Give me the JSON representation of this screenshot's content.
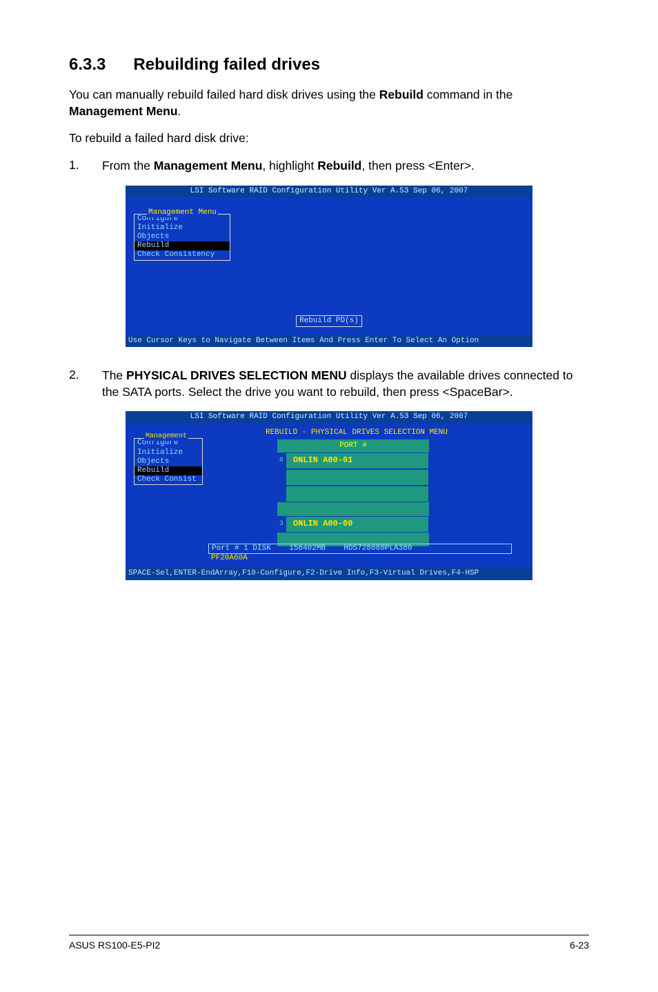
{
  "heading": {
    "num": "6.3.3",
    "title": "Rebuilding failed drives"
  },
  "intro_p1_a": "You can manually rebuild failed hard disk drives using the ",
  "intro_p1_b": "Rebuild",
  "intro_p1_c": " command in the ",
  "intro_p1_d": "Management Menu",
  "intro_p1_e": ".",
  "intro_p2": "To rebuild a failed hard disk drive:",
  "step1": {
    "num": "1.",
    "a": "From the ",
    "b": "Management Menu",
    "c": ", highlight ",
    "d": "Rebuild",
    "e": ", then press <Enter>."
  },
  "step2": {
    "num": "2.",
    "a": "The ",
    "b": "PHYSICAL DRIVES SELECTION MENU",
    "c": " displays the available drives connected to the SATA ports. Select the drive you want to rebuild, then press <SpaceBar>."
  },
  "term": {
    "title": "LSI Software RAID Configuration Utility Ver A.53 Sep 06, 2007",
    "mgmt_title": "Management Menu",
    "items": [
      "Configure",
      "Initialize",
      "Objects",
      "Rebuild",
      "Check Consistency"
    ],
    "mgmt_title_sm": "Management",
    "items_sm": [
      "Configure",
      "Initialize",
      "Objects",
      "Rebuild",
      "Check Consist"
    ],
    "rebuild_box": "Rebuild PD(s)",
    "footer1": "Use Cursor Keys to Navigate Between Items And Press Enter To Select An Option",
    "rebuild_frame_title": "REBUILD - PHYSICAL DRIVES SELECTION MENU",
    "port_header": "PORT #",
    "drives": [
      {
        "idx": "0",
        "label": "ONLIN A00-01"
      },
      {
        "idx": "",
        "label": ""
      },
      {
        "idx": "",
        "label": ""
      },
      {
        "idx": "3",
        "label": "ONLIN A00-00"
      }
    ],
    "disk_info_top": "Port # 1 DISK    156402MB    HDS728080PLA380",
    "disk_info_bottom": "PF20A60A",
    "footer2": "SPACE-Sel,ENTER-EndArray,F10-Configure,F2-Drive Info,F3-Virtual Drives,F4-HSP"
  },
  "footer": {
    "left": "ASUS RS100-E5-PI2",
    "right": "6-23"
  }
}
